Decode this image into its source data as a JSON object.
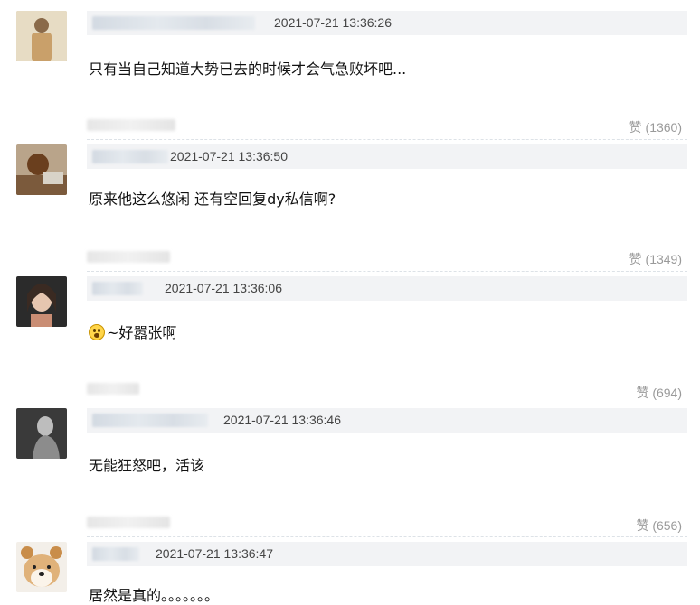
{
  "comments": [
    {
      "timestamp": "2021-07-21 13:36:26",
      "text": "只有当自己知道大势已去的时候才会气急败坏吧...",
      "like_label": "赞",
      "like_count": "(1360)"
    },
    {
      "timestamp": "2021-07-21 13:36:50",
      "text": "原来他这么悠闲 还有空回复dy私信啊?",
      "like_label": "赞",
      "like_count": "(1349)"
    },
    {
      "timestamp": "2021-07-21 13:36:06",
      "text": "~好嚣张啊",
      "emoji": "astonished-face-icon",
      "like_label": "赞",
      "like_count": "(694)"
    },
    {
      "timestamp": "2021-07-21 13:36:46",
      "text": "无能狂怒吧，活该",
      "like_label": "赞",
      "like_count": "(656)"
    },
    {
      "timestamp": "2021-07-21 13:36:47",
      "text": "居然是真的。。。。。。。"
    }
  ],
  "colors": {
    "header_bar": "#f2f3f5",
    "like_text": "#9a9a9a",
    "body_text": "#111111"
  }
}
